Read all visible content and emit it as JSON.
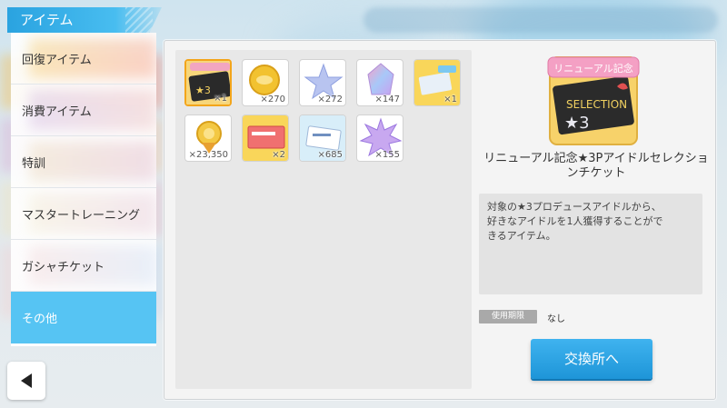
{
  "header": {
    "title": "アイテム"
  },
  "sidebar": {
    "items": [
      {
        "label": "回復アイテム"
      },
      {
        "label": "消費アイテム"
      },
      {
        "label": "特訓"
      },
      {
        "label": "マスタートレーニング"
      },
      {
        "label": "ガシャチケット"
      },
      {
        "label": "その他",
        "active": true
      }
    ]
  },
  "items": [
    {
      "name": "renewal-selection-ticket",
      "count": "×1",
      "selected": true
    },
    {
      "name": "gold-coin",
      "count": "×270"
    },
    {
      "name": "silver-star",
      "count": "×272"
    },
    {
      "name": "rainbow-crystal",
      "count": "×147"
    },
    {
      "name": "gold-ticket",
      "count": "×1"
    },
    {
      "name": "gold-medal",
      "count": "×23,350"
    },
    {
      "name": "red-ticket",
      "count": "×2"
    },
    {
      "name": "blue-ticket",
      "count": "×685"
    },
    {
      "name": "purple-star",
      "count": "×155"
    }
  ],
  "detail": {
    "icon_banner": "リニューアル記念",
    "icon_text": "SELECTION",
    "title": "リニューアル記念★3Pアイドルセレクションチケット",
    "description_line1": "対象の★3プロデュースアイドルから、",
    "description_line2": "好きなアイドルを1人獲得することがで",
    "description_line3": "きるアイテム。",
    "expiry_label": "使用期限",
    "expiry_value": "なし",
    "exchange_button": "交換所へ"
  },
  "colors": {
    "accent": "#2aa3e0",
    "active_tab": "#56c4f3",
    "selected_border": "#f3a51b",
    "button": "#1e95d8"
  }
}
